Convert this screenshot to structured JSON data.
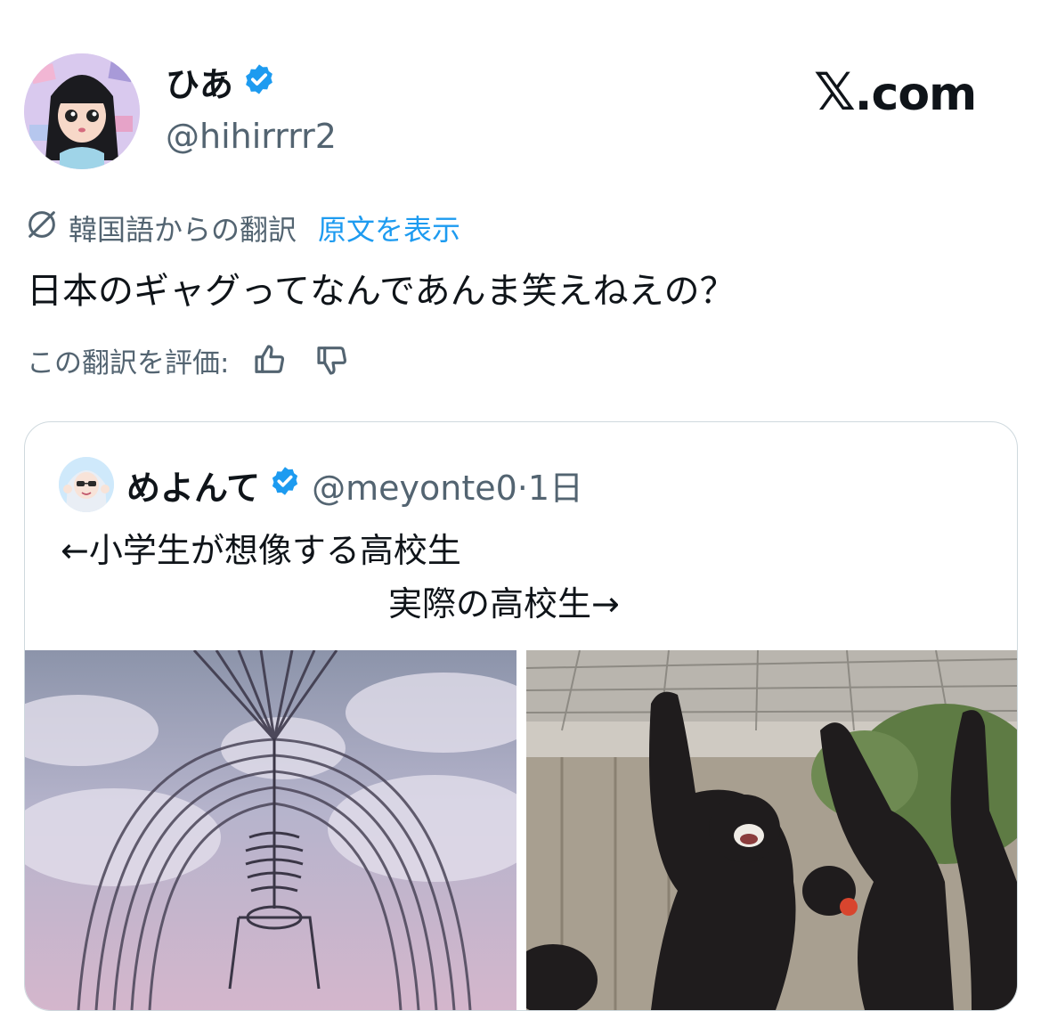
{
  "author": {
    "display_name": "ひあ",
    "handle": "@hihirrrr2",
    "verified": true,
    "avatar_icon": "anime-girl-avatar-icon"
  },
  "brand": {
    "mark": "𝕏",
    "domain": ".com",
    "accent": "#1d9bf0"
  },
  "translation": {
    "icon": "translate-globe-icon",
    "label": "韓国語からの翻訳",
    "show_original": "原文を表示"
  },
  "tweet": {
    "text": "日本のギャグってなんであんま笑えねえの？"
  },
  "rating": {
    "label": "この翻訳を評価:",
    "like_icon": "thumbs-up-icon",
    "dislike_icon": "thumbs-down-icon"
  },
  "quote": {
    "display_name": "めよんて",
    "handle": "@meyonte0",
    "separator": "·",
    "time": "1日",
    "line1": "←小学生が想像する高校生",
    "line2": "実際の高校生→",
    "media": [
      {
        "icon": "skeleton-illustration-image"
      },
      {
        "icon": "chimpanzees-photo-image"
      }
    ]
  }
}
